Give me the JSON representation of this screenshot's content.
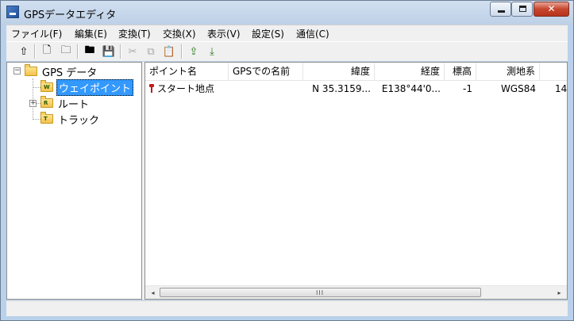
{
  "window": {
    "title": "GPSデータエディタ"
  },
  "window_controls": {
    "minimize": "—",
    "maximize": "□",
    "close": "✕"
  },
  "menu": {
    "items": [
      "ファイル(F)",
      "編集(E)",
      "変換(T)",
      "交換(X)",
      "表示(V)",
      "設定(S)",
      "通信(C)"
    ]
  },
  "toolbar": {
    "buttons": [
      {
        "icon": "up-folder-icon",
        "glyph": "⇧",
        "enabled": true
      },
      {
        "icon": "new-file-icon",
        "glyph": "🗋",
        "enabled": true
      },
      {
        "icon": "new-folder-icon",
        "glyph": "🗀",
        "enabled": true
      },
      {
        "icon": "open-icon",
        "glyph": "🖿",
        "enabled": true
      },
      {
        "icon": "save-icon",
        "glyph": "💾",
        "enabled": true
      },
      {
        "icon": "cut-icon",
        "glyph": "✂",
        "enabled": false
      },
      {
        "icon": "copy-icon",
        "glyph": "⧉",
        "enabled": false
      },
      {
        "icon": "paste-icon",
        "glyph": "📋",
        "enabled": false
      },
      {
        "icon": "upload-icon",
        "glyph": "⇪",
        "enabled": true
      },
      {
        "icon": "download-icon",
        "glyph": "⤓",
        "enabled": true
      }
    ]
  },
  "tree": {
    "root": {
      "label": "GPS データ",
      "expander": "−"
    },
    "children": [
      {
        "label": "ウェイポイント",
        "badge": "W",
        "selected": true
      },
      {
        "label": "ルート",
        "badge": "R",
        "expander": "+"
      },
      {
        "label": "トラック",
        "badge": "T"
      }
    ]
  },
  "table": {
    "columns": [
      "ポイント名",
      "GPSでの名前",
      "緯度",
      "経度",
      "標高",
      "測地系"
    ],
    "rows": [
      {
        "name": "スタート地点",
        "gps_name": "",
        "lat": "N 35.3159...",
        "lon": "E138°44'0...",
        "elev": "-1",
        "datum": "WGS84",
        "extra": "14"
      }
    ]
  },
  "scrollbar": {
    "left": "◂",
    "right": "▸",
    "grip": "III"
  },
  "colors": {
    "selection": "#3399ff",
    "titlebar": "#b9d1ea",
    "close": "#c7462e"
  }
}
